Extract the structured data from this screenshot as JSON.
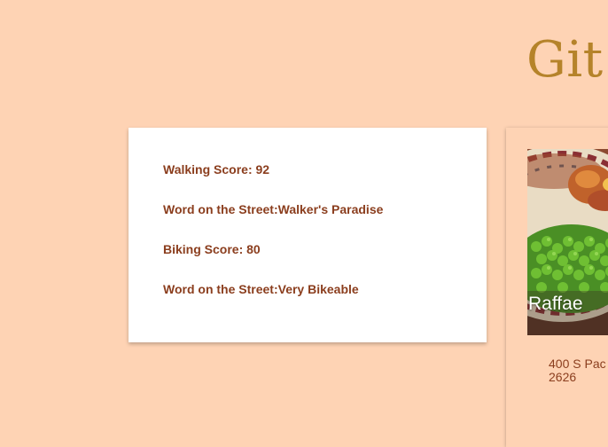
{
  "header": {
    "site_title": "Git"
  },
  "scores": {
    "walking_score": "Walking Score: 92",
    "walking_word": "Word on the Street:Walker's Paradise",
    "biking_score": "Biking Score: 80",
    "biking_word": "Word on the Street:Very Bikeable"
  },
  "restaurant": {
    "name": "Raffae",
    "address_line1": "400 S Pac",
    "address_line2": "2626"
  },
  "colors": {
    "page_background": "#fed3b4",
    "title": "#b5832a",
    "score_text": "#8b3e1e"
  }
}
